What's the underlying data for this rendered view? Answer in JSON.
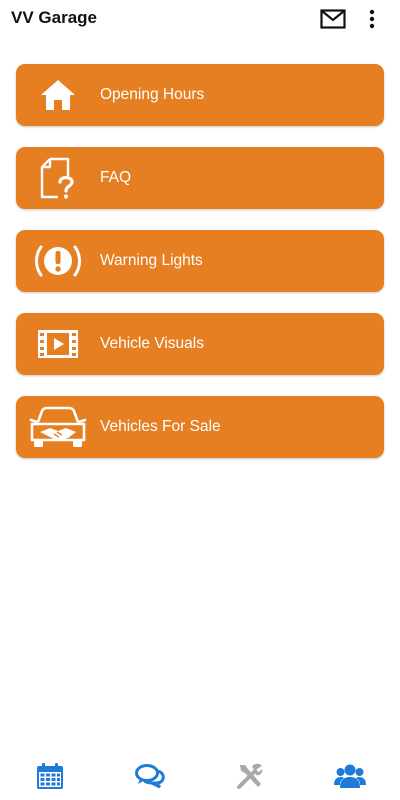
{
  "app_bar": {
    "title": "VV Garage",
    "icons": [
      "mail-icon",
      "more-vert-icon"
    ]
  },
  "menu": {
    "items": [
      {
        "label": "Opening Hours",
        "icon": "home-icon"
      },
      {
        "label": "FAQ",
        "icon": "faq-document-icon"
      },
      {
        "label": "Warning Lights",
        "icon": "warning-light-icon"
      },
      {
        "label": "Vehicle Visuals",
        "icon": "video-film-icon"
      },
      {
        "label": "Vehicles For Sale",
        "icon": "car-handshake-icon"
      }
    ]
  },
  "bottom_nav": {
    "items": [
      {
        "icon": "calendar-icon",
        "color": "#1E7BD8"
      },
      {
        "icon": "chat-icon",
        "color": "#1E7BD8"
      },
      {
        "icon": "tools-icon",
        "color": "#A9A9A9"
      },
      {
        "icon": "users-icon",
        "color": "#1E7BD8"
      }
    ]
  },
  "colors": {
    "accent": "#E67E22",
    "nav_active": "#1E7BD8",
    "nav_inactive": "#A9A9A9"
  }
}
